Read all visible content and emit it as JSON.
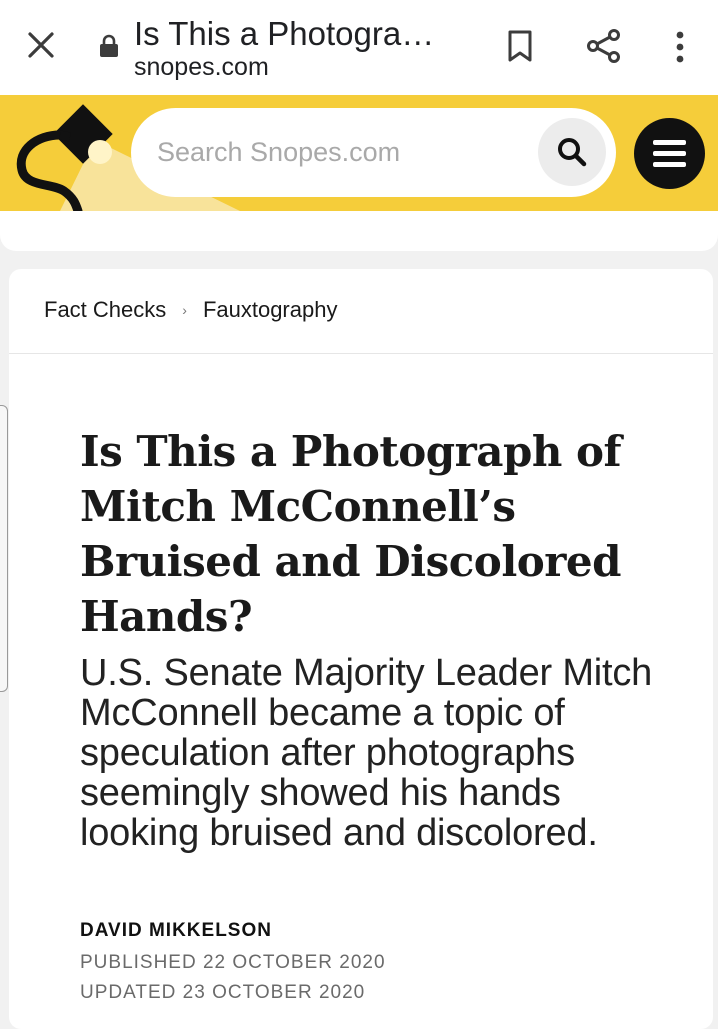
{
  "browser": {
    "tab_title": "Is This a Photogra…",
    "domain": "snopes.com",
    "icons": [
      "close-icon",
      "lock-icon",
      "bookmark-icon",
      "share-icon",
      "more-vert-icon"
    ]
  },
  "header": {
    "search_placeholder": "Search Snopes.com",
    "brand_color": "#f5cd3a",
    "icons": [
      "snopes-logo",
      "search-icon",
      "hamburger-menu-icon"
    ]
  },
  "breadcrumb": {
    "items": [
      {
        "label": "Fact Checks"
      },
      {
        "label": "Fauxtography"
      }
    ],
    "separator": "›"
  },
  "article": {
    "title": "Is This a Photograph of Mitch McConnell’s Bruised and Discolored Hands?",
    "subtitle": "U.S. Senate Majority Leader Mitch McConnell became a topic of speculation after photographs seemingly showed his hands looking bruised and discolored.",
    "author": "DAVID MIKKELSON",
    "published": "PUBLISHED 22 OCTOBER 2020",
    "updated": "UPDATED 23 OCTOBER 2020"
  }
}
